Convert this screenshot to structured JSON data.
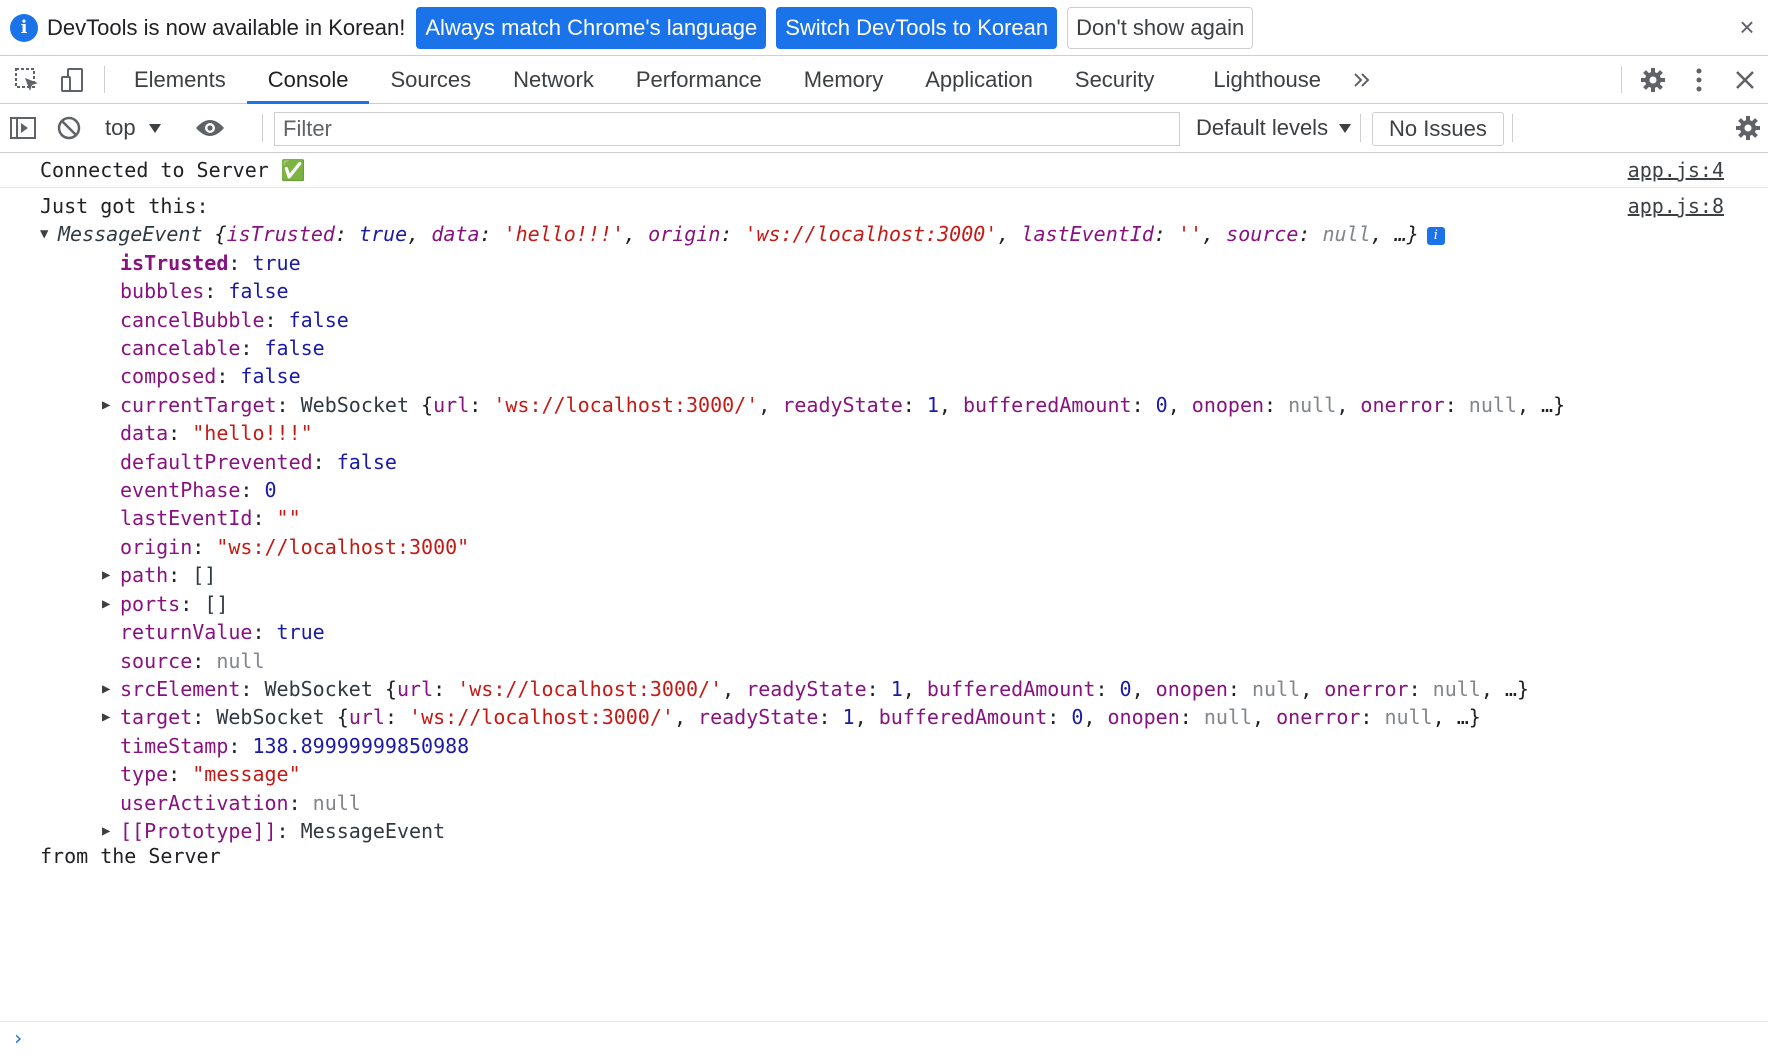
{
  "infobar": {
    "message": "DevTools is now available in Korean!",
    "btn_match": "Always match Chrome's language",
    "btn_switch": "Switch DevTools to Korean",
    "btn_dont_show": "Don't show again",
    "close": "×"
  },
  "tabs": [
    "Elements",
    "Console",
    "Sources",
    "Network",
    "Performance",
    "Memory",
    "Application",
    "Security",
    "Lighthouse"
  ],
  "active_tab": "Console",
  "toolbar": {
    "context": "top",
    "filter_placeholder": "Filter",
    "levels": "Default levels",
    "issues": "No Issues"
  },
  "console": {
    "msg1": {
      "text": "Connected to Server",
      "emoji": "✅",
      "source": "app.js:4"
    },
    "msg2": {
      "text": "Just got this:",
      "source": "app.js:8",
      "summary": {
        "class": "MessageEvent",
        "isTrusted": "true",
        "data": "'hello!!!'",
        "origin": "'ws://localhost:3000'",
        "lastEventId": "''",
        "source": "null"
      },
      "props": {
        "isTrusted": "true",
        "bubbles": "false",
        "cancelBubble": "false",
        "cancelable": "false",
        "composed": "false",
        "currentTarget_url": "'ws://localhost:3000/'",
        "data": "\"hello!!!\"",
        "defaultPrevented": "false",
        "eventPhase": "0",
        "lastEventId": "\"\"",
        "origin": "\"ws://localhost:3000\"",
        "path": "[]",
        "ports": "[]",
        "returnValue": "true",
        "source": "null",
        "timeStamp": "138.89999999850988",
        "type": "\"message\"",
        "userActivation": "null",
        "prototype": "MessageEvent"
      },
      "websocket": {
        "class": "WebSocket",
        "url": "'ws://localhost:3000/'",
        "readyState": "1",
        "bufferedAmount": "0",
        "onopen": "null",
        "onerror": "null"
      },
      "tail": "from the Server"
    }
  }
}
